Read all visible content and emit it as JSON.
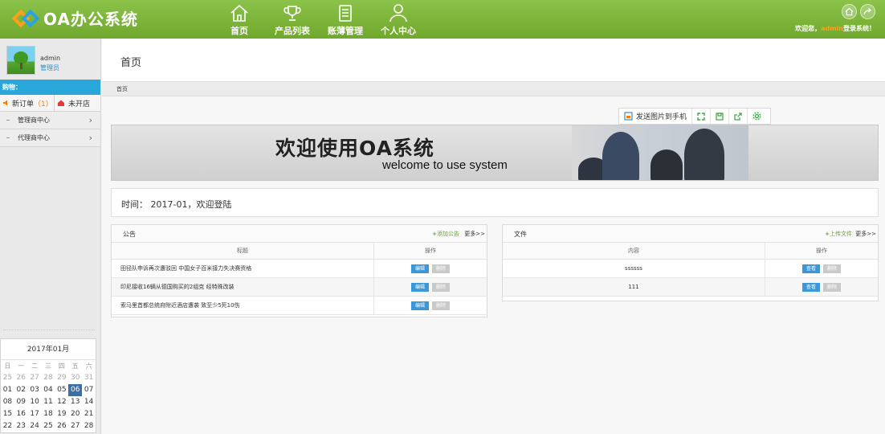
{
  "header": {
    "logo_text": "OA办公系统",
    "nav": [
      {
        "label": "首页",
        "icon": "home-icon"
      },
      {
        "label": "产品列表",
        "icon": "trophy-icon"
      },
      {
        "label": "账薄管理",
        "icon": "ledger-icon"
      },
      {
        "label": "个人中心",
        "icon": "user-icon"
      }
    ],
    "welcome_prefix": "欢迎您，",
    "welcome_user": "admin",
    "welcome_suffix": "登录系统！"
  },
  "sidebar": {
    "username": "admin",
    "role": "管理员",
    "section_title": "购物：",
    "new_order_label": "新订单",
    "new_order_count": "（1）",
    "closed_label": "未开店",
    "menu": [
      {
        "label": "管理商中心"
      },
      {
        "label": "代理商中心"
      }
    ],
    "calendar": {
      "title": "2017年01月",
      "weekdays": [
        "日",
        "一",
        "二",
        "三",
        "四",
        "五",
        "六"
      ],
      "rows": [
        [
          "25",
          "26",
          "27",
          "28",
          "29",
          "30",
          "31"
        ],
        [
          "01",
          "02",
          "03",
          "04",
          "05",
          "06",
          "07"
        ],
        [
          "08",
          "09",
          "10",
          "11",
          "12",
          "13",
          "14"
        ],
        [
          "15",
          "16",
          "17",
          "18",
          "19",
          "20",
          "21"
        ],
        [
          "22",
          "23",
          "24",
          "25",
          "26",
          "27",
          "28"
        ]
      ],
      "today": "06"
    }
  },
  "main": {
    "page_title": "首页",
    "breadcrumb": "首页",
    "toolbar": {
      "send_label": "发送图片到手机"
    },
    "banner": {
      "title_cn": "欢迎使用OA系统",
      "title_en": "welcome to use system"
    },
    "time_text": "时间： 2017-01，欢迎登陆",
    "notices": {
      "title": "公告",
      "add_label": "添加公告",
      "more_label": "更多>>",
      "col_title": "标题",
      "col_action": "操作",
      "edit_label": "编辑",
      "delete_label": "删除",
      "rows": [
        "田径队申诉再次遭驳回 中国女子百米接力失决赛资格",
        "印尼接收16辆从德国购买的2组克 经特殊改装",
        "索马里首都总统府附近酒店遭袭 致至少5死10伤"
      ]
    },
    "files": {
      "title": "文件",
      "add_label": "上传文件",
      "more_label": "更多>>",
      "col_content": "内容",
      "col_action": "操作",
      "view_label": "查看",
      "delete_label": "删除",
      "rows": [
        "ssssss",
        "111"
      ]
    }
  }
}
